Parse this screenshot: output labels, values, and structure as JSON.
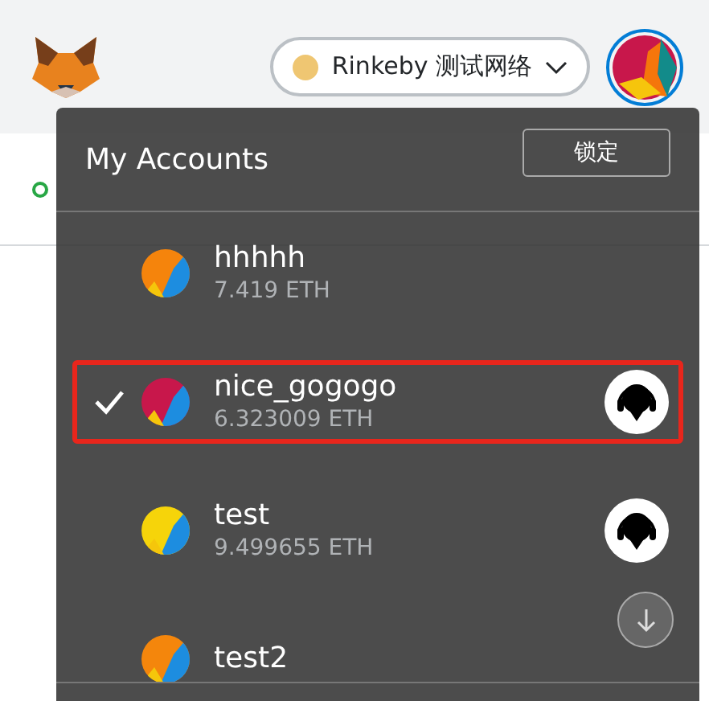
{
  "network": {
    "name": "Rinkeby 测试网络",
    "color": "#efc672"
  },
  "menu": {
    "title": "My Accounts",
    "lock_button": "锁定",
    "accounts": [
      {
        "name": "hhhhh",
        "balance": "7.419 ETH",
        "selected": false,
        "imported": false,
        "color": "#f5840c"
      },
      {
        "name": "nice_gogogo",
        "balance": "6.323009 ETH",
        "selected": true,
        "imported": true,
        "color": "#c8174b"
      },
      {
        "name": "test",
        "balance": "9.499655 ETH",
        "selected": false,
        "imported": true,
        "color": "#f6d40a"
      },
      {
        "name": "test2",
        "selected": false,
        "imported": false,
        "color": "#f4860c"
      }
    ]
  }
}
